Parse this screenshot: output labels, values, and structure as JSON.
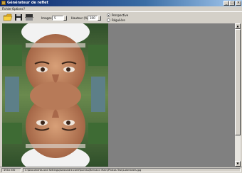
{
  "window": {
    "title": "Générateur de reflet",
    "buttons": [
      "_",
      "□",
      "×"
    ]
  },
  "menu": [
    "Fichier",
    "Options",
    "?"
  ],
  "toolbar": {
    "open_icon": "folder-open-icon",
    "save_icon": "floppy-disk-icon",
    "mirror_icon": "mirror-reflection-icon",
    "images_label": "Images:",
    "images_value": "5",
    "hauteur_label": "Hauteur (%):",
    "hauteur_value": "100",
    "perspective_label": "Perspective",
    "reguliere_label": "Régulière"
  },
  "status": {
    "dimensions": "494×330",
    "path": "C:\\Documents and Settings\\Alexandre.carle\\bureau\\Brenacci Main\\Photos Test\\Lakerbeels.jpg"
  },
  "colors": {
    "title_gradient_start": "#0a246a",
    "title_gradient_end": "#a6caf0",
    "workspace_grey": "#808080",
    "face_skin": "#c98862"
  }
}
